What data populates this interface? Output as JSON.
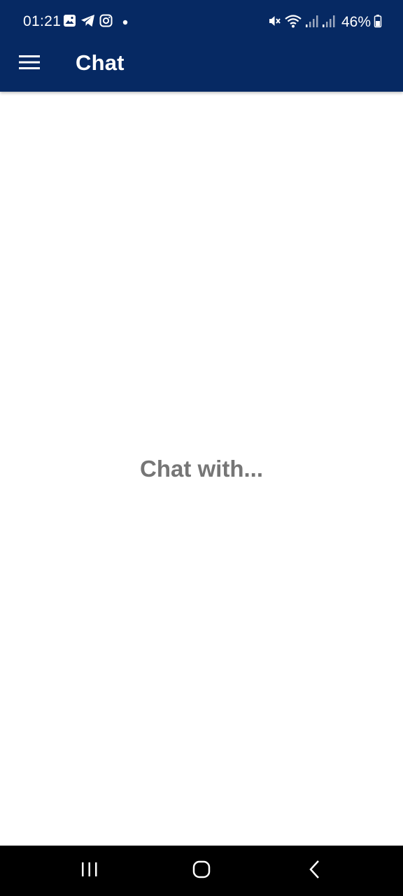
{
  "status_bar": {
    "time": "01:21",
    "battery": "46%",
    "notification_icons": [
      "gallery-icon",
      "telegram-icon",
      "instagram-icon",
      "dot-icon"
    ],
    "system_icons": [
      "mute-icon",
      "wifi-icon",
      "signal-icon",
      "signal-icon",
      "battery-icon"
    ]
  },
  "app_bar": {
    "title": "Chat",
    "menu_icon": "hamburger-menu-icon",
    "background": "#062963"
  },
  "main": {
    "empty_text": "Chat with..."
  },
  "nav_bar": {
    "buttons": [
      "recents-icon",
      "home-icon",
      "back-icon"
    ]
  }
}
